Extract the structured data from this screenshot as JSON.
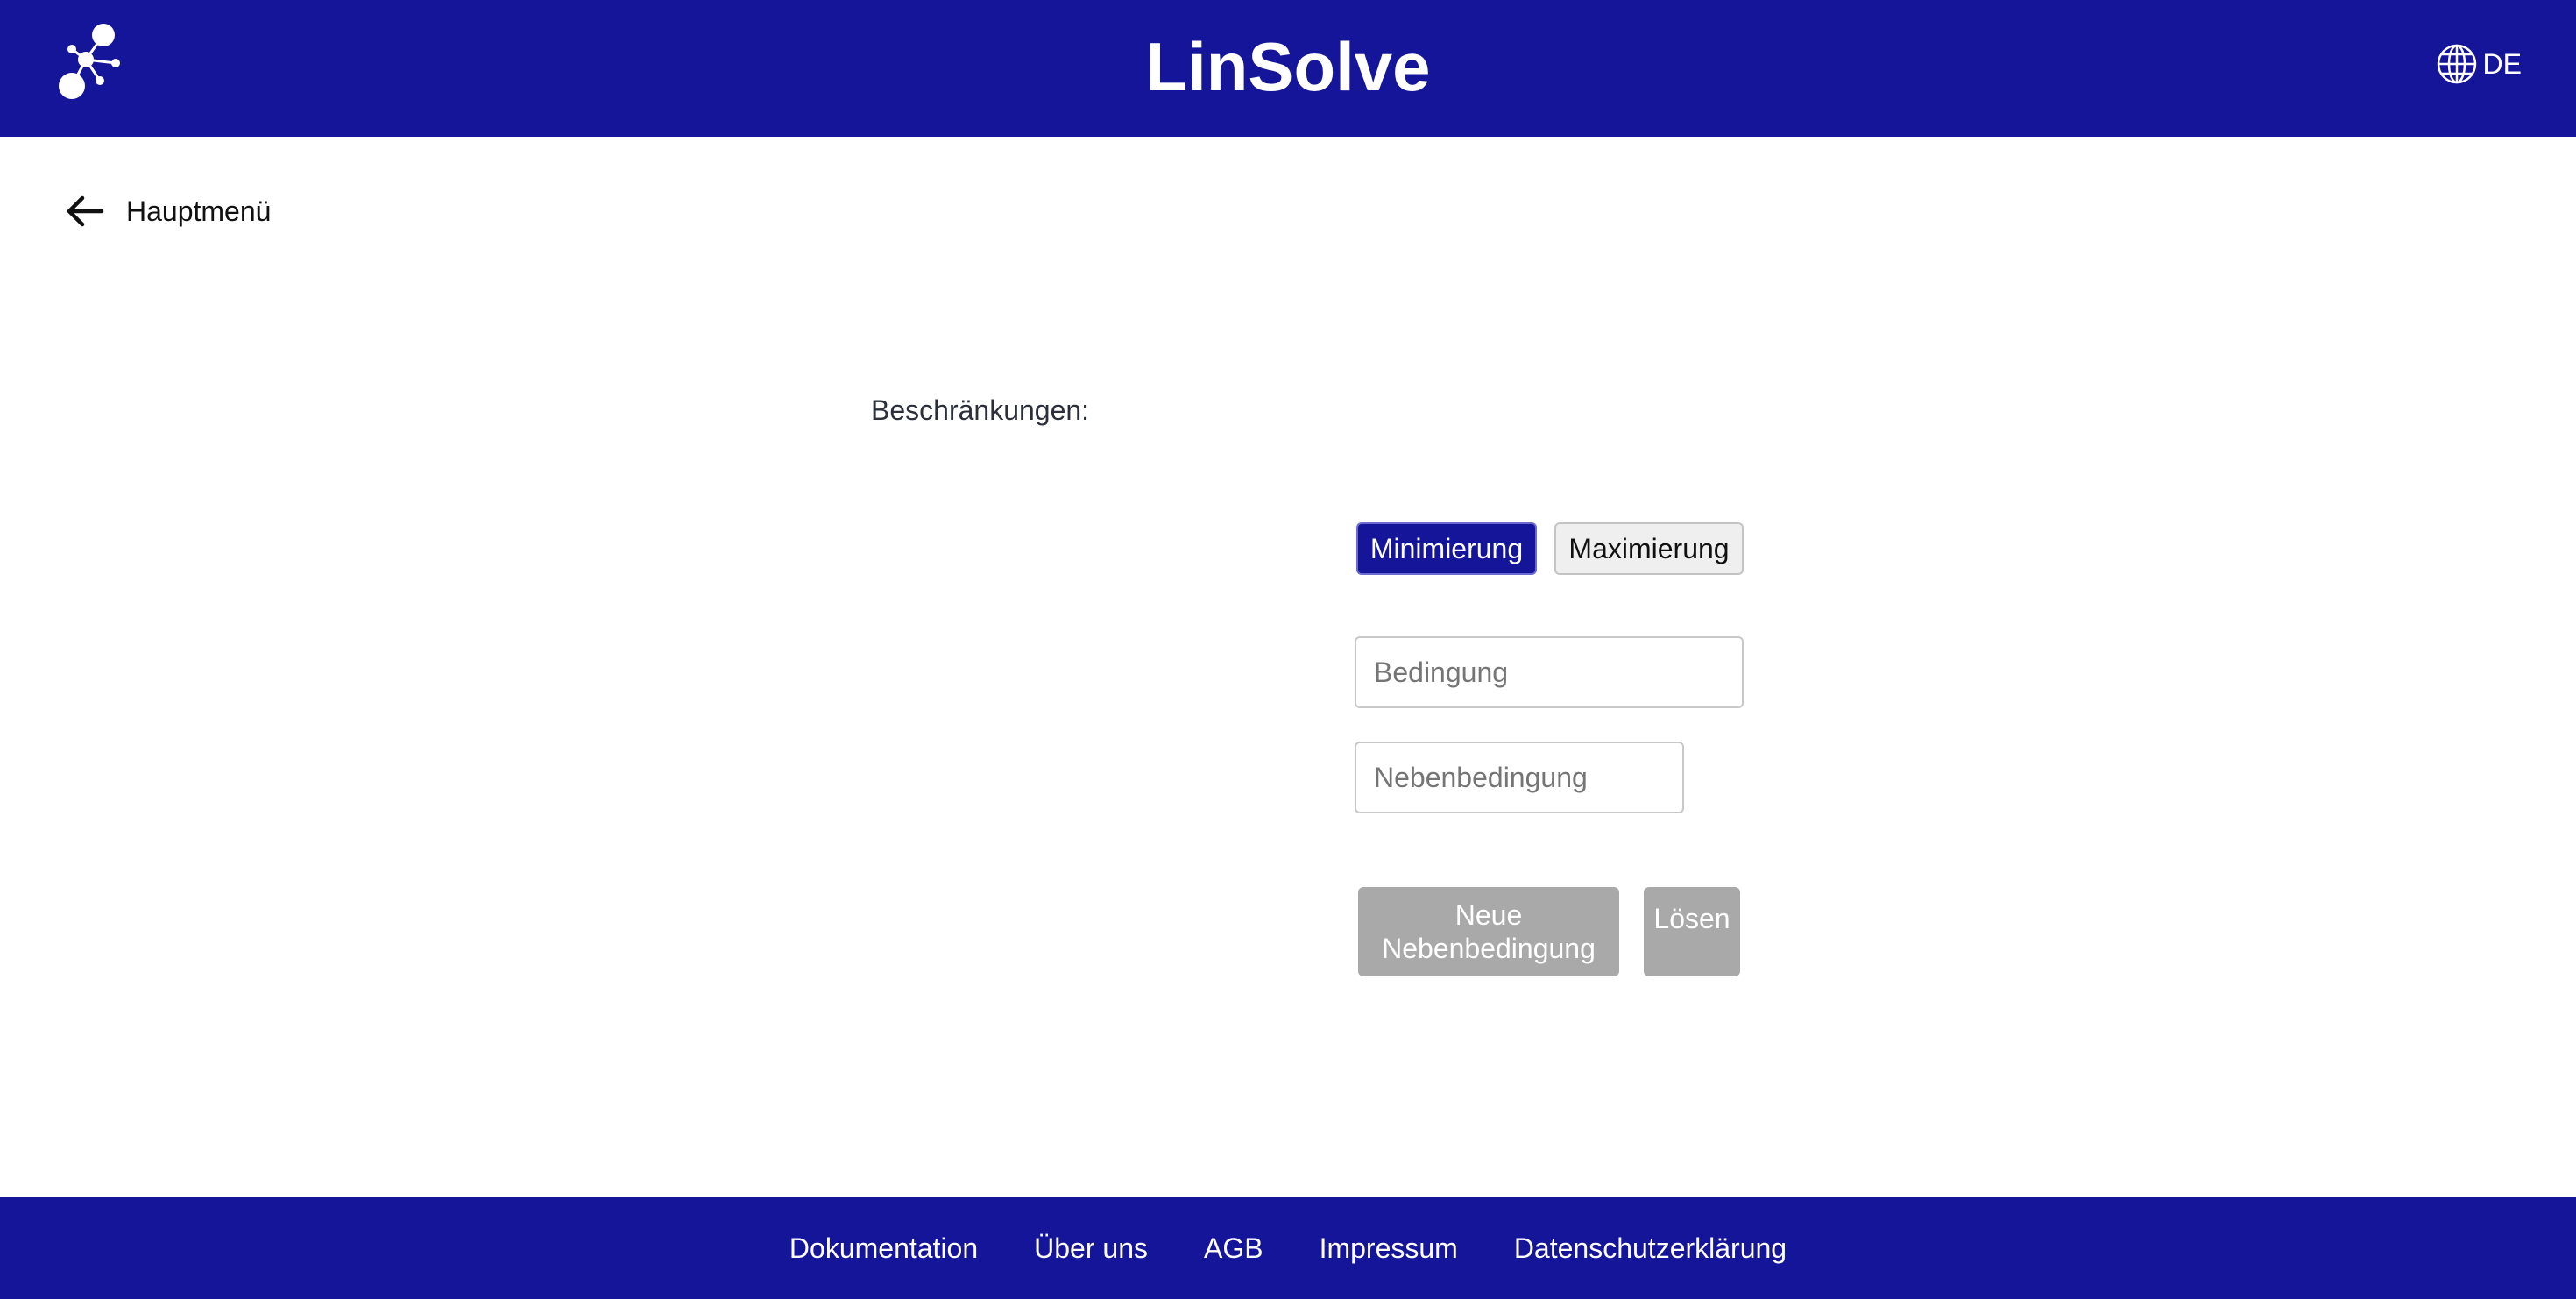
{
  "header": {
    "title": "LinSolve",
    "language": "DE"
  },
  "nav": {
    "back_label": "Hauptmenü"
  },
  "form": {
    "section_label": "Beschränkungen:",
    "mode_options": [
      "Minimierung",
      "Maximierung"
    ],
    "selected_mode": "Minimierung",
    "condition_placeholder": "Bedingung",
    "condition_value": "",
    "constraint_placeholder": "Nebenbedingung",
    "constraint_value": "",
    "new_constraint_label": "Neue Nebenbedingung",
    "solve_label": "Lösen"
  },
  "footer": {
    "links": [
      "Dokumentation",
      "Über uns",
      "AGB",
      "Impressum",
      "Datenschutzerklärung"
    ]
  },
  "colors": {
    "brand": "#15159a",
    "disabled": "#a9a9a9"
  },
  "icons": {
    "logo": "molecule-network-icon",
    "language": "globe-icon",
    "back": "arrow-left-icon"
  }
}
